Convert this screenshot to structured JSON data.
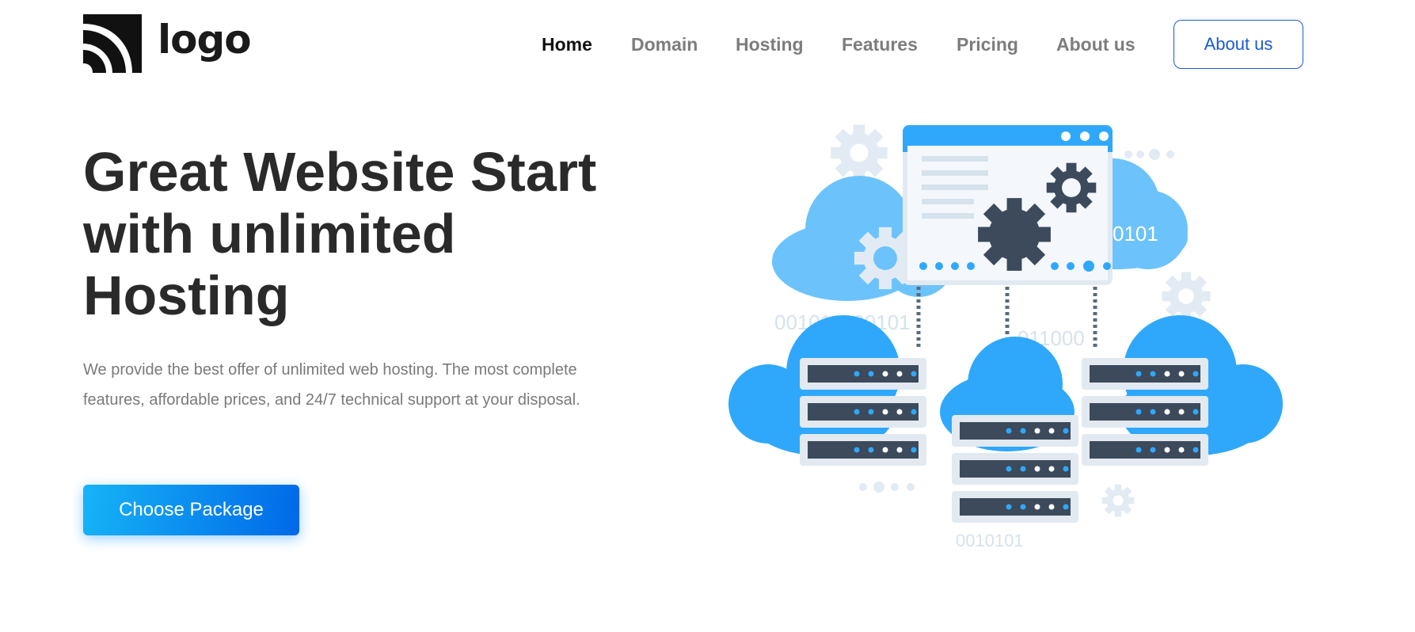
{
  "logo": {
    "text": "logo"
  },
  "nav": {
    "items": [
      {
        "label": "Home",
        "active": true
      },
      {
        "label": "Domain",
        "active": false
      },
      {
        "label": "Hosting",
        "active": false
      },
      {
        "label": "Features",
        "active": false
      },
      {
        "label": "Pricing",
        "active": false
      },
      {
        "label": "About us",
        "active": false
      }
    ],
    "cta_label": "About us"
  },
  "hero": {
    "title": "Great Website Start with unlimited Hosting",
    "description": "We provide the best offer of unlimited web hosting. The most complete features, affordable prices, and 24/7 technical support at your disposal.",
    "button_label": "Choose Package"
  },
  "illustration": {
    "binary_labels": [
      "001011000101",
      "011000",
      "0101",
      "0010101"
    ]
  },
  "colors": {
    "accent_blue": "#1a5bd0",
    "cloud_light": "#6cc3fb",
    "cloud_blue": "#2fa8fb",
    "server_dark": "#3c4a5c",
    "server_frame": "#e3e9f0",
    "gear_light": "#e2ebf3",
    "binary_text": "#d6e2ec"
  }
}
